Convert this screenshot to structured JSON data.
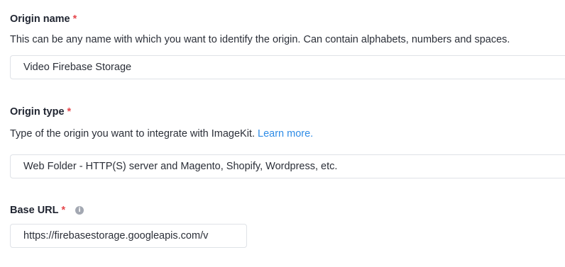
{
  "origin_name": {
    "label": "Origin name",
    "required_mark": "*",
    "help": "This can be any name with which you want to identify the origin. Can contain alphabets, numbers and spaces.",
    "value": "Video Firebase Storage"
  },
  "origin_type": {
    "label": "Origin type",
    "required_mark": "*",
    "help": "Type of the origin you want to integrate with ImageKit.",
    "learn_more": "Learn more.",
    "selected": "Web Folder - HTTP(S) server and Magento, Shopify, Wordpress, etc."
  },
  "base_url": {
    "label": "Base URL",
    "required_mark": "*",
    "info_icon": "info-circle-icon",
    "value": "https://firebasestorage.googleapis.com/v"
  },
  "colors": {
    "required": "#e5484d",
    "link": "#2f8ce6",
    "border": "#dfe2e7"
  }
}
